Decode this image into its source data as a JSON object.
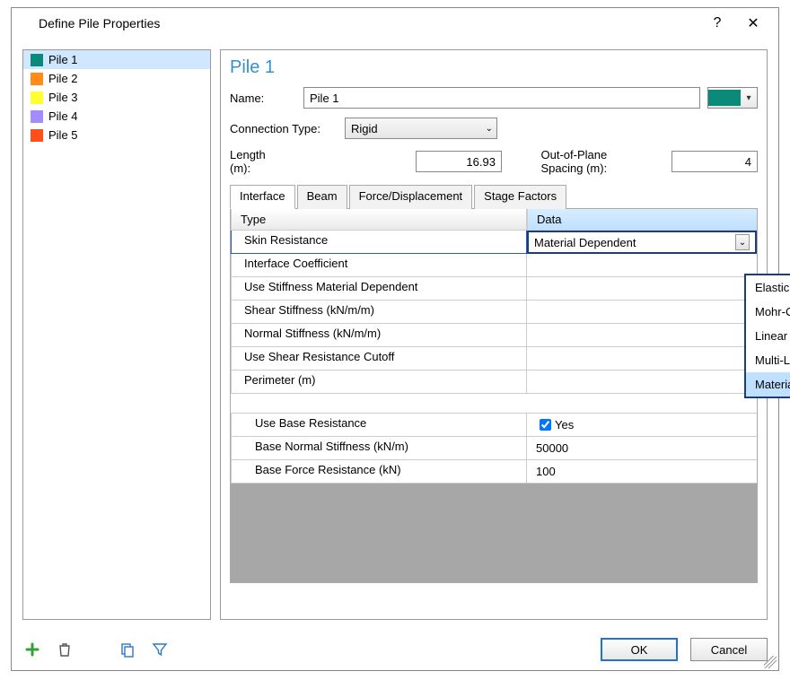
{
  "window": {
    "title": "Define Pile Properties"
  },
  "pile_list": {
    "items": [
      {
        "label": "Pile 1",
        "color": "#0b8a7a",
        "selected": true
      },
      {
        "label": "Pile 2",
        "color": "#ff8c1a",
        "selected": false
      },
      {
        "label": "Pile 3",
        "color": "#ffff33",
        "selected": false
      },
      {
        "label": "Pile 4",
        "color": "#a38cff",
        "selected": false
      },
      {
        "label": "Pile 5",
        "color": "#ff4f1a",
        "selected": false
      }
    ]
  },
  "main": {
    "heading": "Pile 1",
    "name_label": "Name:",
    "name_value": "Pile 1",
    "color_value": "#0b8a7a",
    "conn_label": "Connection Type:",
    "conn_value": "Rigid",
    "length_label": "Length (m):",
    "length_value": "16.93",
    "oop_label": "Out-of-Plane Spacing (m):",
    "oop_value": "4",
    "tabs": [
      {
        "label": "Interface",
        "active": true
      },
      {
        "label": "Beam",
        "active": false
      },
      {
        "label": "Force/Displacement",
        "active": false
      },
      {
        "label": "Stage Factors",
        "active": false
      }
    ],
    "grid": {
      "headers": {
        "type": "Type",
        "data": "Data"
      },
      "top_rows": [
        {
          "label": "Skin Resistance"
        },
        {
          "label": "Interface Coefficient"
        },
        {
          "label": "Use Stiffness Material Dependent"
        },
        {
          "label": "Shear Stiffness (kN/m/m)"
        },
        {
          "label": "Normal Stiffness (kN/m/m)"
        },
        {
          "label": "Use Shear Resistance Cutoff"
        },
        {
          "label": "Perimeter (m)"
        }
      ],
      "skin_value": "Material Dependent",
      "dropdown_options": [
        "Elastic",
        "Mohr-Coulomb",
        "Linear",
        "Multi-Linear",
        "Material Dependent"
      ],
      "bottom_rows": [
        {
          "label": "Use Base Resistance",
          "value_checkbox": true,
          "value_text": "Yes"
        },
        {
          "label": "Base Normal Stiffness (kN/m)",
          "value": "50000"
        },
        {
          "label": "Base Force Resistance (kN)",
          "value": "100"
        }
      ]
    }
  },
  "footer": {
    "ok": "OK",
    "cancel": "Cancel",
    "icons": {
      "add": "add-icon",
      "delete": "delete-icon",
      "copy": "copy-icon",
      "filter": "filter-icon"
    }
  }
}
